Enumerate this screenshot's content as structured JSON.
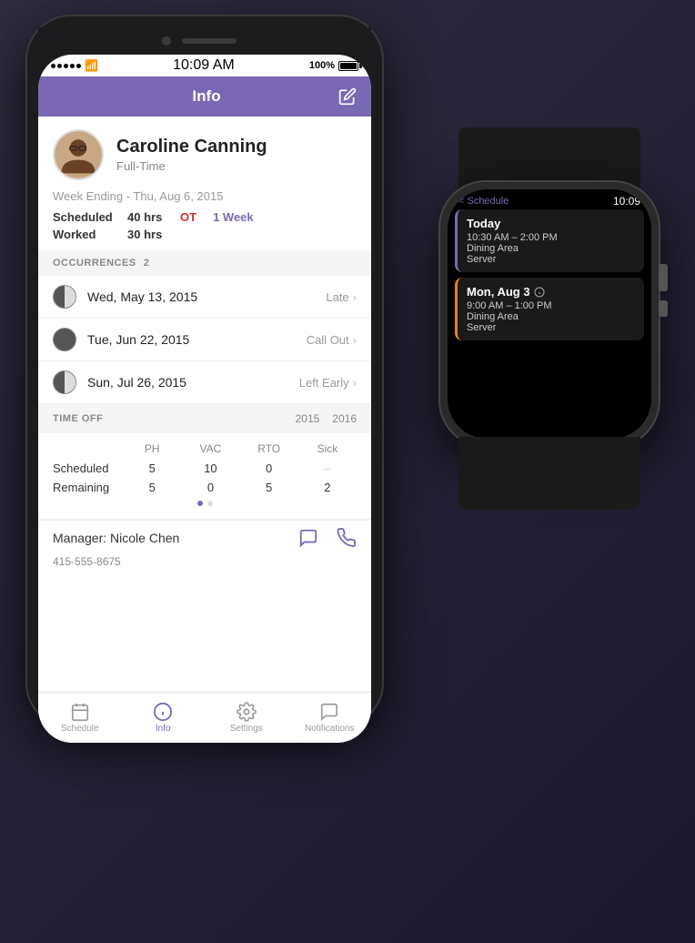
{
  "phone": {
    "status_bar": {
      "dots": [
        "●",
        "●",
        "●",
        "●",
        "●"
      ],
      "wifi": "wifi",
      "time": "10:09 AM",
      "battery_pct": "100%"
    },
    "nav": {
      "title": "Info",
      "edit_icon": "edit"
    },
    "profile": {
      "name": "Caroline Canning",
      "type": "Full-Time",
      "week_ending": "Week Ending - Thu, Aug 6, 2015",
      "rows": [
        {
          "label": "Scheduled",
          "value": "40 hrs",
          "ot": "OT",
          "week": "1 Week"
        },
        {
          "label": "Worked",
          "value": "30 hrs"
        }
      ]
    },
    "occurrences": {
      "header": "OCCURRENCES",
      "count": "2",
      "items": [
        {
          "icon": "half",
          "date": "Wed, May 13, 2015",
          "type": "Late"
        },
        {
          "icon": "full",
          "date": "Tue, Jun 22, 2015",
          "type": "Call Out"
        },
        {
          "icon": "half",
          "date": "Sun, Jul 26, 2015",
          "type": "Left Early"
        }
      ]
    },
    "time_off": {
      "title": "TIME OFF",
      "year1": "2015",
      "year2": "2016",
      "columns": [
        "PH",
        "VAC",
        "RTO",
        "Sick"
      ],
      "rows": [
        {
          "label": "Scheduled",
          "ph": "5",
          "vac": "10",
          "rto": "0",
          "sick": "–"
        },
        {
          "label": "Remaining",
          "ph": "5",
          "vac": "0",
          "rto": "5",
          "sick": "2"
        }
      ]
    },
    "manager": {
      "label": "Manager: Nicole Chen",
      "phone_number": "415-555-8675"
    },
    "tabs": [
      {
        "label": "Schedule",
        "icon": "grid",
        "active": false
      },
      {
        "label": "Info",
        "icon": "clock",
        "active": true
      },
      {
        "label": "Settings",
        "icon": "gear",
        "active": false
      },
      {
        "label": "Notifications",
        "icon": "message",
        "active": false
      }
    ]
  },
  "watch": {
    "back_label": "< Schedule",
    "time": "10:09",
    "cards": [
      {
        "title": "Today",
        "time": "10:30 AM – 2:00 PM",
        "location": "Dining Area",
        "role": "Server",
        "accent": "#7b68b5"
      },
      {
        "title": "Mon, Aug 3",
        "time": "9:00 AM – 1:00 PM",
        "location": "Dining Area",
        "role": "Server",
        "accent": "#e8821a"
      }
    ]
  },
  "colors": {
    "purple": "#7b68b5",
    "orange": "#e8821a",
    "red": "#cc3333",
    "gray_bg": "#f5f5f7",
    "text_dark": "#222222",
    "text_mid": "#888888",
    "text_light": "#cccccc"
  }
}
